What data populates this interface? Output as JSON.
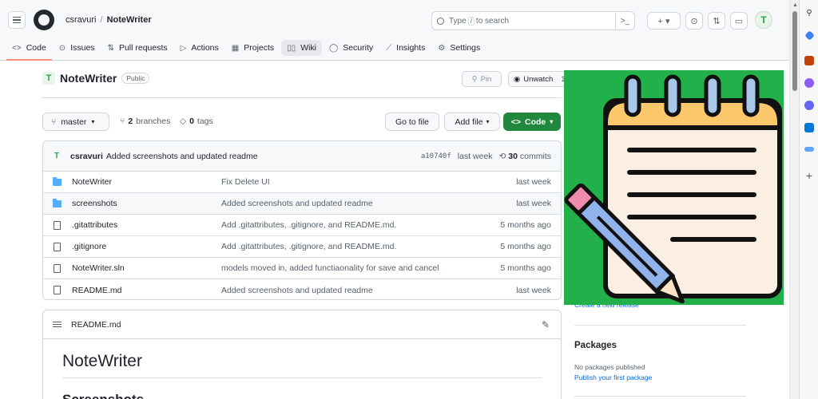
{
  "header": {
    "owner": "csravuri",
    "separator": "/",
    "repo": "NoteWriter",
    "search_prefix": "Type",
    "search_key": "/",
    "search_suffix": "to search",
    "cmd_symbol": ">_",
    "plus_symbol": "+ ▾",
    "issues_symbol": "⊙",
    "pr_symbol": "⇅",
    "inbox_symbol": "▭",
    "avatar_glyph": "T"
  },
  "tabs": [
    {
      "icon": "<>",
      "label": "Code"
    },
    {
      "icon": "⊙",
      "label": "Issues"
    },
    {
      "icon": "⇅",
      "label": "Pull requests"
    },
    {
      "icon": "▷",
      "label": "Actions"
    },
    {
      "icon": "▦",
      "label": "Projects"
    },
    {
      "icon": "▯▯",
      "label": "Wiki"
    },
    {
      "icon": "◯",
      "label": "Security"
    },
    {
      "icon": "⟋",
      "label": "Insights"
    },
    {
      "icon": "⚙",
      "label": "Settings"
    }
  ],
  "repo": {
    "avatar_glyph": "T",
    "name": "NoteWriter",
    "visibility": "Public",
    "pin_label": "Pin",
    "watch_label": "Unwatch",
    "watch_count": "1"
  },
  "branch": {
    "current": "master",
    "branches_count": "2",
    "branches_label": "branches",
    "tags_count": "0",
    "tags_label": "tags",
    "goto_file": "Go to file",
    "add_file": "Add file",
    "code_label": "Code"
  },
  "commit": {
    "author": "csravuri",
    "message": "Added screenshots and updated readme",
    "sha": "a10740f",
    "time": "last week",
    "count": "30",
    "count_label": "commits"
  },
  "files": [
    {
      "type": "folder",
      "name": "NoteWriter",
      "message": "Fix Delete UI",
      "age": "last week"
    },
    {
      "type": "folder",
      "name": "screenshots",
      "message": "Added screenshots and updated readme",
      "age": "last week"
    },
    {
      "type": "file",
      "name": ".gitattributes",
      "message": "Add .gitattributes, .gitignore, and README.md.",
      "age": "5 months ago"
    },
    {
      "type": "file",
      "name": ".gitignore",
      "message": "Add .gitattributes, .gitignore, and README.md.",
      "age": "5 months ago"
    },
    {
      "type": "file",
      "name": "NoteWriter.sln",
      "message": "models moved in, added functiaonality for save and cancel",
      "age": "5 months ago"
    },
    {
      "type": "file",
      "name": "README.md",
      "message": "Added screenshots and updated readme",
      "age": "last week"
    }
  ],
  "readme": {
    "filename": "README.md",
    "heading": "NoteWriter",
    "subheading": "Screenshots"
  },
  "sidebar": {
    "create_release": "Create a new release",
    "packages_title": "Packages",
    "packages_none": "No packages published",
    "packages_link": "Publish your first package"
  },
  "colors": {
    "accent_green": "#1f883d",
    "link_blue": "#0969da",
    "tab_underline": "#fd8c73",
    "image_bg": "#22b04b"
  }
}
